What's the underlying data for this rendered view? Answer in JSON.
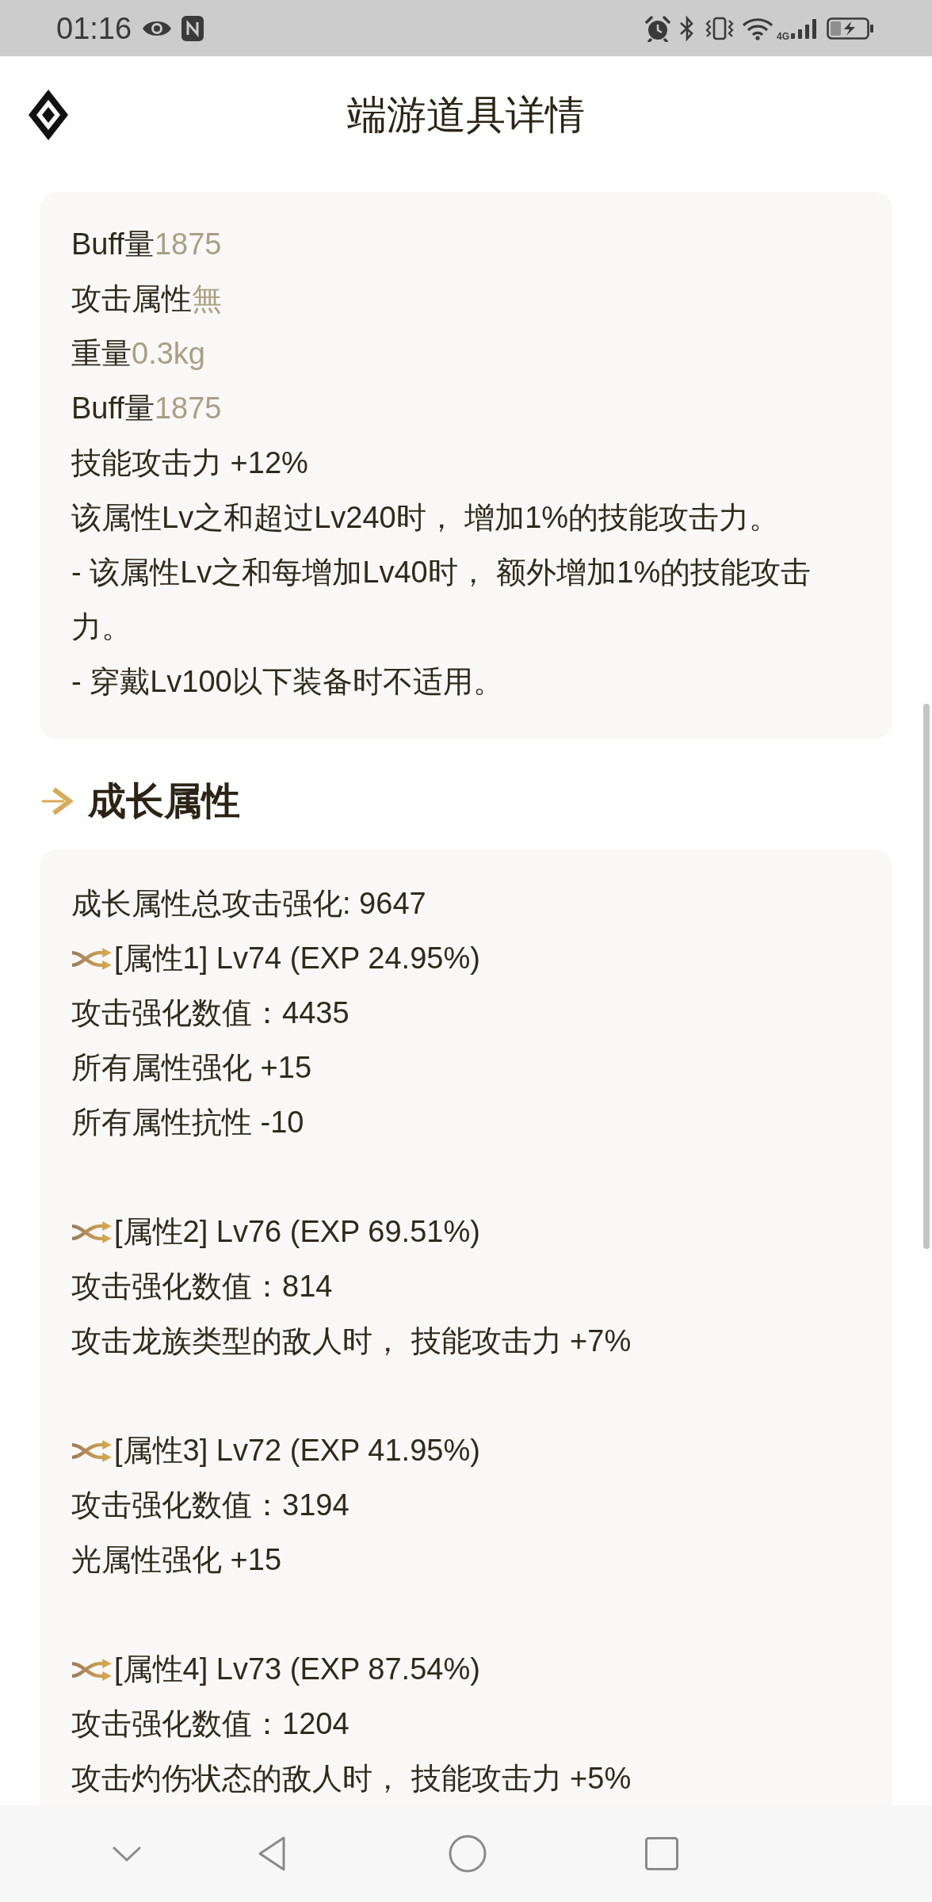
{
  "status_bar": {
    "time": "01:16",
    "network_type": "4G"
  },
  "header": {
    "title": "端游道具详情"
  },
  "item_stats": {
    "lines": [
      {
        "kind": "pair",
        "label": "Buff量",
        "value": "1875"
      },
      {
        "kind": "pair",
        "label": "攻击属性",
        "value": "無"
      },
      {
        "kind": "pair",
        "label": "重量",
        "value": "0.3kg"
      },
      {
        "kind": "pair",
        "label": "Buff量",
        "value": "1875"
      },
      {
        "kind": "text",
        "text": "技能攻击力 +12%"
      },
      {
        "kind": "text",
        "text": "该属性Lv之和超过Lv240时， 增加1%的技能攻击力。"
      },
      {
        "kind": "text",
        "text": "- 该属性Lv之和每增加Lv40时， 额外增加1%的技能攻击力。"
      },
      {
        "kind": "text",
        "text": "- 穿戴Lv100以下装备时不适用。"
      }
    ]
  },
  "growth_section": {
    "title": "成长属性",
    "total": "成长属性总攻击强化: 9647",
    "attributes": [
      {
        "heading": "[属性1] Lv74 (EXP 24.95%)",
        "effects": [
          "攻击强化数值：4435",
          "所有属性强化 +15",
          "所有属性抗性 -10"
        ]
      },
      {
        "heading": "[属性2] Lv76 (EXP 69.51%)",
        "effects": [
          "攻击强化数值：814",
          "攻击龙族类型的敌人时， 技能攻击力 +7%"
        ]
      },
      {
        "heading": "[属性3] Lv72 (EXP 41.95%)",
        "effects": [
          "攻击强化数值：3194",
          "光属性强化 +15"
        ]
      },
      {
        "heading": "[属性4] Lv73 (EXP 87.54%)",
        "effects": [
          "攻击强化数值：1204",
          "攻击灼伤状态的敌人时， 技能攻击力 +5%"
        ]
      }
    ]
  }
}
